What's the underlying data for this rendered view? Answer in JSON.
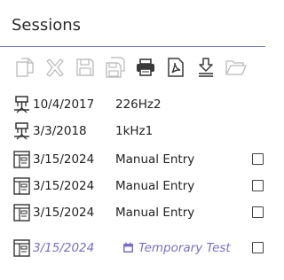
{
  "title": "Sessions",
  "toolbar": {
    "buttons": [
      {
        "name": "copy-icon"
      },
      {
        "name": "delete-icon"
      },
      {
        "name": "save-icon"
      },
      {
        "name": "save-all-icon"
      },
      {
        "name": "print-icon"
      },
      {
        "name": "pdf-icon"
      },
      {
        "name": "download-icon"
      },
      {
        "name": "folder-icon"
      }
    ]
  },
  "sessions": [
    {
      "date": "10/4/2017",
      "name": "226Hz2",
      "icon": "tripod-icon",
      "checkbox": false,
      "temporary": false
    },
    {
      "date": "3/3/2018",
      "name": "1kHz1",
      "icon": "tripod-icon",
      "checkbox": false,
      "temporary": false
    },
    {
      "date": "3/15/2024",
      "name": "Manual Entry",
      "icon": "manual-entry-icon",
      "checkbox": true,
      "temporary": false
    },
    {
      "date": "3/15/2024",
      "name": "Manual Entry",
      "icon": "manual-entry-icon",
      "checkbox": true,
      "temporary": false
    },
    {
      "date": "3/15/2024",
      "name": "Manual Entry",
      "icon": "manual-entry-icon",
      "checkbox": true,
      "temporary": false
    },
    {
      "date": "3/15/2024",
      "name": "Temporary Test",
      "icon": "manual-entry-icon",
      "checkbox": true,
      "temporary": true,
      "tag_icon": "calendar-icon"
    }
  ],
  "colors": {
    "accent": "#7c6fc3",
    "rule": "#7a7fb0",
    "disabled_icon": "#b9b9b9",
    "enabled_icon": "#3a3a3a"
  }
}
